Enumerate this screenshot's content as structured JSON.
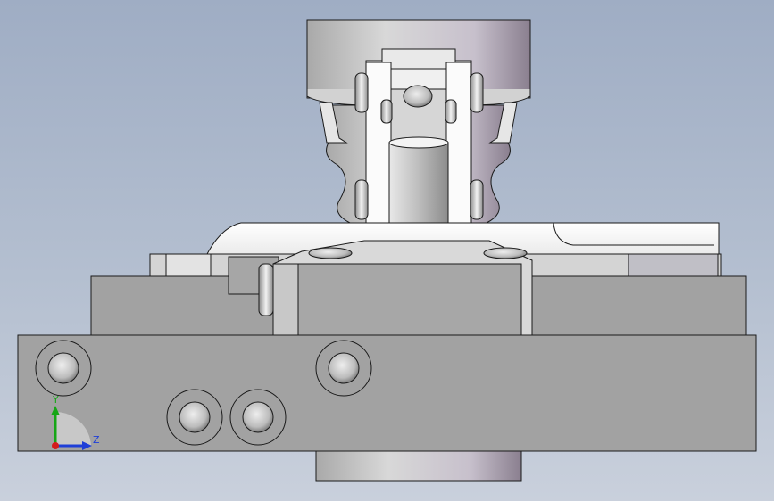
{
  "triad": {
    "y_label": "Y",
    "z_label": "Z",
    "y_color": "#16a616",
    "z_color": "#1f3fd8",
    "x_color": "#d41c1c"
  },
  "colors": {
    "background_top": "#9fadc4",
    "background_bottom": "#c9d0dc",
    "body_gray": "#a2a2a2",
    "outline": "#1a1a1a"
  }
}
